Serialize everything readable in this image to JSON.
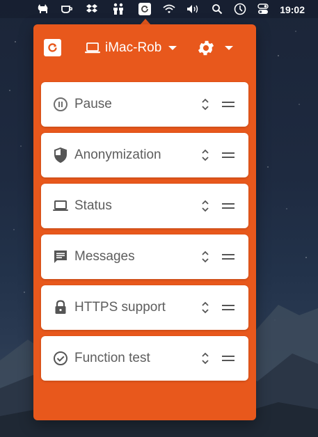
{
  "menubar": {
    "icons": [
      "cat-icon",
      "cup-icon",
      "dropbox-icon",
      "people-icon",
      "app-icon",
      "wifi-icon",
      "volume-icon",
      "search-icon",
      "clock-icon",
      "control-center-icon"
    ],
    "time": "19:02"
  },
  "header": {
    "device_name": "iMac-Rob",
    "device_icon": "laptop-icon",
    "settings_icon": "gear-icon"
  },
  "items": [
    {
      "label": "Pause",
      "icon": "pause-circle-icon"
    },
    {
      "label": "Anonymization",
      "icon": "shield-icon"
    },
    {
      "label": "Status",
      "icon": "laptop-icon"
    },
    {
      "label": "Messages",
      "icon": "message-icon"
    },
    {
      "label": "HTTPS support",
      "icon": "lock-icon"
    },
    {
      "label": "Function test",
      "icon": "check-circle-icon"
    }
  ],
  "colors": {
    "accent": "#e8581c",
    "card_bg": "#ffffff",
    "text": "#5d5d5d",
    "icon": "#6e6e6e"
  }
}
